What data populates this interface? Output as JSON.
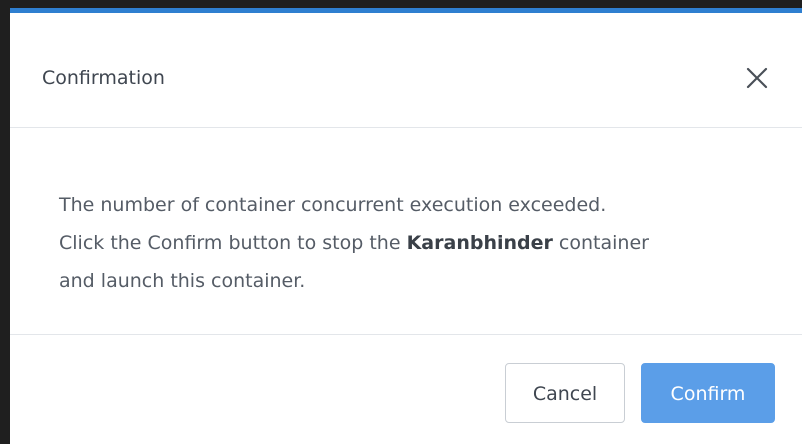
{
  "dialog": {
    "title": "Confirmation",
    "close_icon": "close-icon",
    "message": {
      "line1": "The number of container concurrent execution exceeded.",
      "line2_prefix": "Click the Confirm button to stop the ",
      "container_name": "Karanbhinder",
      "line2_suffix": " container",
      "line3": "and launch this container."
    },
    "buttons": {
      "cancel_label": "Cancel",
      "confirm_label": "Confirm"
    },
    "colors": {
      "accent_top_border": "#2f7fd0",
      "confirm_button": "#5b9ee8"
    }
  }
}
